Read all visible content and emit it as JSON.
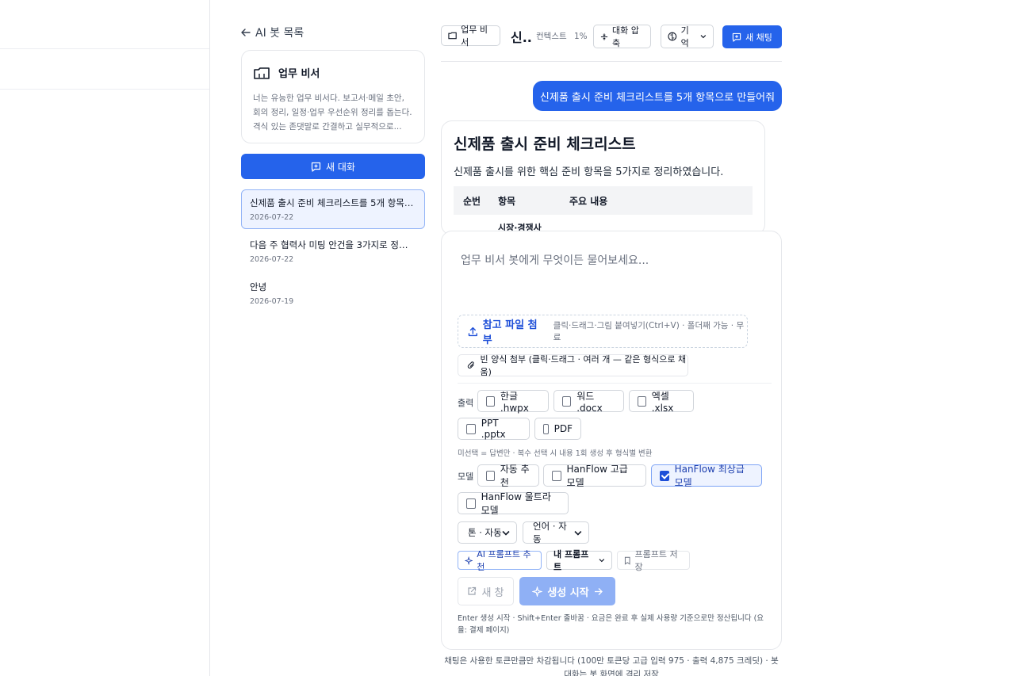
{
  "nav": {
    "back_label": "AI 봇 목록"
  },
  "bot": {
    "name": "업무 비서",
    "description": "너는 유능한 업무 비서다. 보고서·메일 초안, 회의 정리, 일정·업무 우선순위 정리를 돕는다. 격식 있는 존댓말로 간결하고 실무적으로..."
  },
  "sidebar": {
    "new_chat_label": "새 대화",
    "conversations": [
      {
        "title": "신제품 출시 준비 체크리스트를 5개 항목으로 ...",
        "date": "2026-07-22",
        "active": true
      },
      {
        "title": "다음 주 협력사 미팅 안건을 3가지로 정리해줘",
        "date": "2026-07-22",
        "active": false
      },
      {
        "title": "안녕",
        "date": "2026-07-19",
        "active": false
      }
    ]
  },
  "header": {
    "bot_chip": "업무 비서",
    "title": "신..",
    "context_label": "컨텍스트",
    "context_value": "1%",
    "compress_label": "대화 압축",
    "memory_label": "기억",
    "new_chat_label": "새 채팅"
  },
  "messages": {
    "user": "신제품 출시 준비 체크리스트를 5개 항목으로 만들어줘",
    "assistant": {
      "heading": "신제품 출시 준비 체크리스트",
      "intro": "신제품 출시를 위한 핵심 준비 항목을 5가지로 정리하였습니다.",
      "table_headers": [
        "순번",
        "항목",
        "주요 내용"
      ],
      "first_row_item": "시장·경쟁사"
    }
  },
  "composer": {
    "placeholder": "업무 비서 봇에게 무엇이든 물어보세요...",
    "attach_label": "참고 파일 첨부",
    "attach_hint": "클릭·드래그·그림 붙여넣기(Ctrl+V) · 폴더째 가능 · 무료",
    "form_attach_label": "빈 양식 첨부 (클릭·드래그 · 여러 개 — 같은 형식으로 채움)",
    "output_label": "출력",
    "output_options": [
      "한글 .hwpx",
      "워드 .docx",
      "엑셀 .xlsx",
      "PPT .pptx",
      "PDF"
    ],
    "output_hint": "미선택 = 답변만 · 복수 선택 시 내용 1회 생성 후 형식별 변환",
    "model_label": "모델",
    "model_options": [
      "자동 추천",
      "HanFlow 고급 모델",
      "HanFlow 최상급 모델",
      "HanFlow 울트라 모델"
    ],
    "model_selected": "HanFlow 최상급 모델",
    "tone_select": "톤 · 자동",
    "lang_select": "언어 · 자동",
    "ai_prompt_label": "AI 프롬프트 추천",
    "my_prompt_label": "내 프롬프트",
    "save_prompt_label": "프롬프트 저장",
    "new_window_label": "새 창",
    "generate_label": "생성 시작",
    "footer_hint": "Enter 생성 시작 · Shift+Enter 줄바꿈 · 요금은 완료 후 실제 사용량 기준으로만 정산됩니다 (요율: 결제 페이지)"
  },
  "bottom_note": "채팅은 사용한 토큰만큼만 차감됩니다 (100만 토큰당 고급 입력 975 · 출력 4,875 크레딧) · 봇 대화는 봇 화면에 격리 저장",
  "colors": {
    "accent": "#2563eb",
    "accent_disabled": "#8fb0f5",
    "selected_bg": "#eef3ff"
  }
}
